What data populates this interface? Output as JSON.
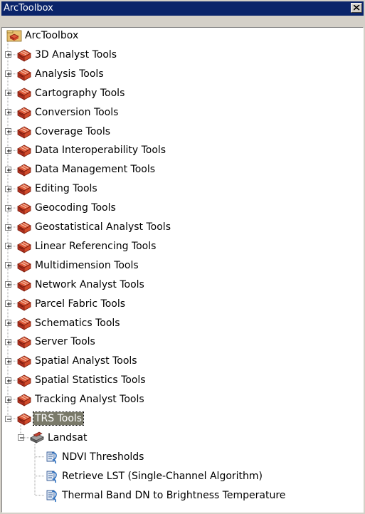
{
  "window": {
    "title": "ArcToolbox",
    "close_glyph": "✕"
  },
  "tree": {
    "root_label": "ArcToolbox",
    "toolboxes": [
      {
        "label": "3D Analyst Tools"
      },
      {
        "label": "Analysis Tools"
      },
      {
        "label": "Cartography Tools"
      },
      {
        "label": "Conversion Tools"
      },
      {
        "label": "Coverage Tools"
      },
      {
        "label": "Data Interoperability Tools"
      },
      {
        "label": "Data Management Tools"
      },
      {
        "label": "Editing Tools"
      },
      {
        "label": "Geocoding Tools"
      },
      {
        "label": "Geostatistical Analyst Tools"
      },
      {
        "label": "Linear Referencing Tools"
      },
      {
        "label": "Multidimension Tools"
      },
      {
        "label": "Network Analyst Tools"
      },
      {
        "label": "Parcel Fabric Tools"
      },
      {
        "label": "Schematics Tools"
      },
      {
        "label": "Server Tools"
      },
      {
        "label": "Spatial Analyst Tools"
      },
      {
        "label": "Spatial Statistics Tools"
      },
      {
        "label": "Tracking Analyst Tools"
      },
      {
        "label": "TRS Tools",
        "expanded": true,
        "selected": true
      }
    ],
    "toolset": {
      "label": "Landsat",
      "expanded": true
    },
    "scripts": [
      {
        "label": "NDVI Thresholds"
      },
      {
        "label": "Retrieve LST (Single-Channel Algorithm)"
      },
      {
        "label": "Thermal Band DN to Brightness Temperature"
      }
    ]
  },
  "icons": {
    "root": "toolbox-folder-icon",
    "toolbox": "red-toolbox-icon",
    "toolset": "toolset-icon",
    "script": "script-icon"
  },
  "colors": {
    "title_bar": "#0a246a",
    "selected_bg": "#7a7a6a",
    "toolbox_red": "#c0392b"
  }
}
